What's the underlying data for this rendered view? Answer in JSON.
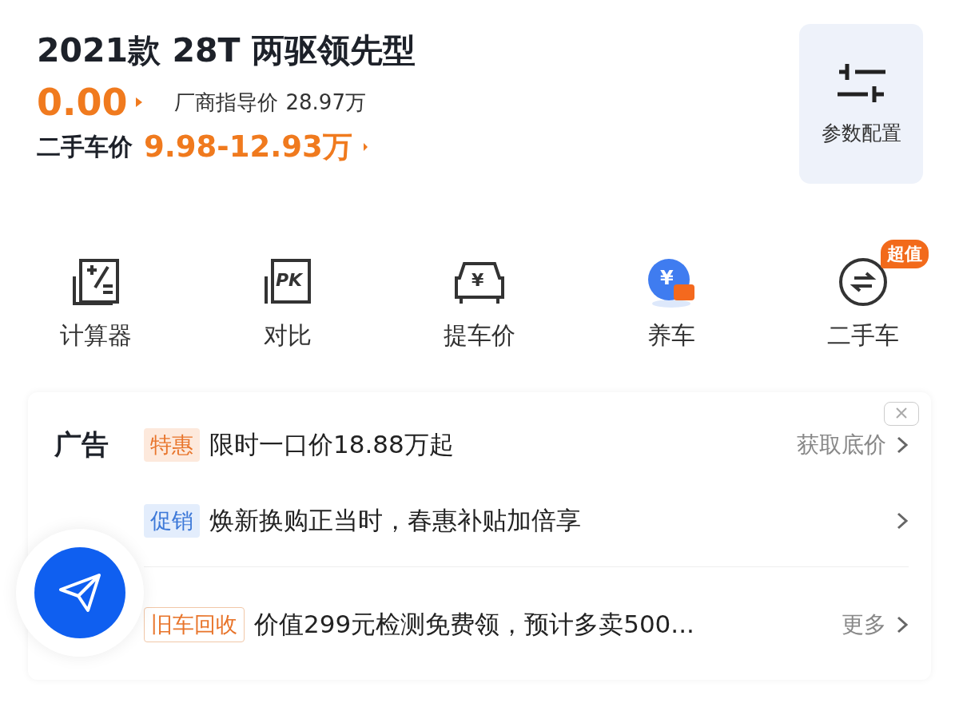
{
  "header": {
    "title": "2021款 28T 两驱领先型",
    "price": "0.00",
    "guide_price_label": "厂商指导价",
    "guide_price": "28.97万",
    "used_price_label": "二手车价",
    "used_price": "9.98-12.93万",
    "specs_button": "参数配置"
  },
  "shortcuts": [
    {
      "kind": "calculator",
      "label": "计算器"
    },
    {
      "kind": "compare",
      "label": "对比",
      "icon_text": "PK"
    },
    {
      "kind": "pickup",
      "label": "提车价",
      "icon_text": "¥"
    },
    {
      "kind": "maintenance",
      "label": "养车",
      "icon_text": "¥"
    },
    {
      "kind": "used",
      "label": "二手车",
      "badge": "超值"
    }
  ],
  "ad": {
    "label": "广告",
    "rows": [
      {
        "tag": "特惠",
        "kind": "orange",
        "text": "限时一口价18.88万起",
        "action": "获取底价",
        "divider_before": false
      },
      {
        "tag": "促销",
        "kind": "blue",
        "text": "焕新换购正当时，春惠补贴加倍享",
        "divider_before": false
      },
      {
        "tag": "旧车回收",
        "kind": "outline",
        "text": "价值299元检测免费领，预计多卖500...",
        "action": "更多",
        "divider_before": true
      }
    ]
  }
}
